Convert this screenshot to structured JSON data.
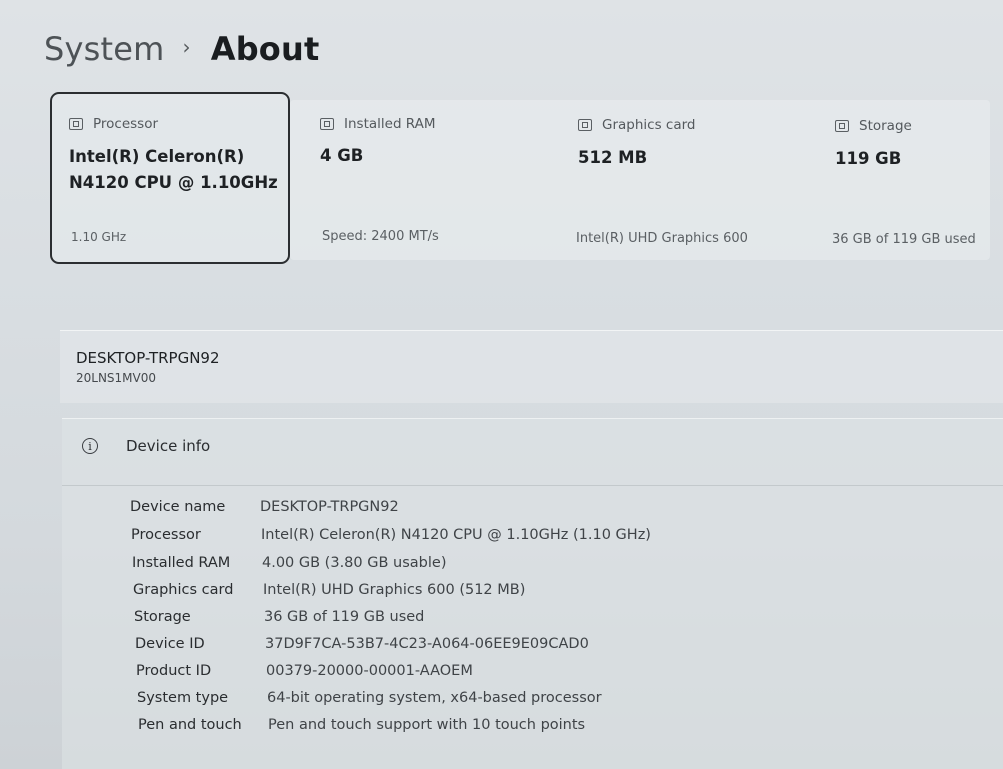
{
  "breadcrumb": {
    "parent": "System",
    "separator": "›",
    "current": "About"
  },
  "spec_cards": [
    {
      "title": "Processor",
      "value_line1": "Intel(R) Celeron(R)",
      "value_line2": "N4120 CPU @ 1.10GHz",
      "sub": "1.10 GHz",
      "icon": "processor-icon"
    },
    {
      "title": "Installed RAM",
      "value_line1": "4 GB",
      "value_line2": "",
      "sub": "Speed: 2400 MT/s",
      "icon": "ram-icon"
    },
    {
      "title": "Graphics card",
      "value_line1": "512 MB",
      "value_line2": "",
      "sub": "Intel(R) UHD Graphics 600",
      "icon": "graphics-card-icon"
    },
    {
      "title": "Storage",
      "value_line1": "119 GB",
      "value_line2": "",
      "sub": "36 GB of 119 GB used",
      "icon": "storage-icon"
    }
  ],
  "device": {
    "name": "DESKTOP-TRPGN92",
    "model": "20LNS1MV00"
  },
  "device_info": {
    "header": "Device info",
    "rows": [
      {
        "label": "Device name",
        "value": "DESKTOP-TRPGN92"
      },
      {
        "label": "Processor",
        "value": "Intel(R) Celeron(R) N4120 CPU @ 1.10GHz (1.10 GHz)"
      },
      {
        "label": "Installed RAM",
        "value": "4.00 GB (3.80 GB usable)"
      },
      {
        "label": "Graphics card",
        "value": "Intel(R) UHD Graphics 600 (512 MB)"
      },
      {
        "label": "Storage",
        "value": "36 GB of 119 GB used"
      },
      {
        "label": "Device ID",
        "value": "37D9F7CA-53B7-4C23-A064-06EE9E09CAD0"
      },
      {
        "label": "Product ID",
        "value": "00379-20000-00001-AAOEM"
      },
      {
        "label": "System type",
        "value": "64-bit operating system, x64-based processor"
      },
      {
        "label": "Pen and touch",
        "value": "Pen and touch support with 10 touch points"
      }
    ]
  }
}
